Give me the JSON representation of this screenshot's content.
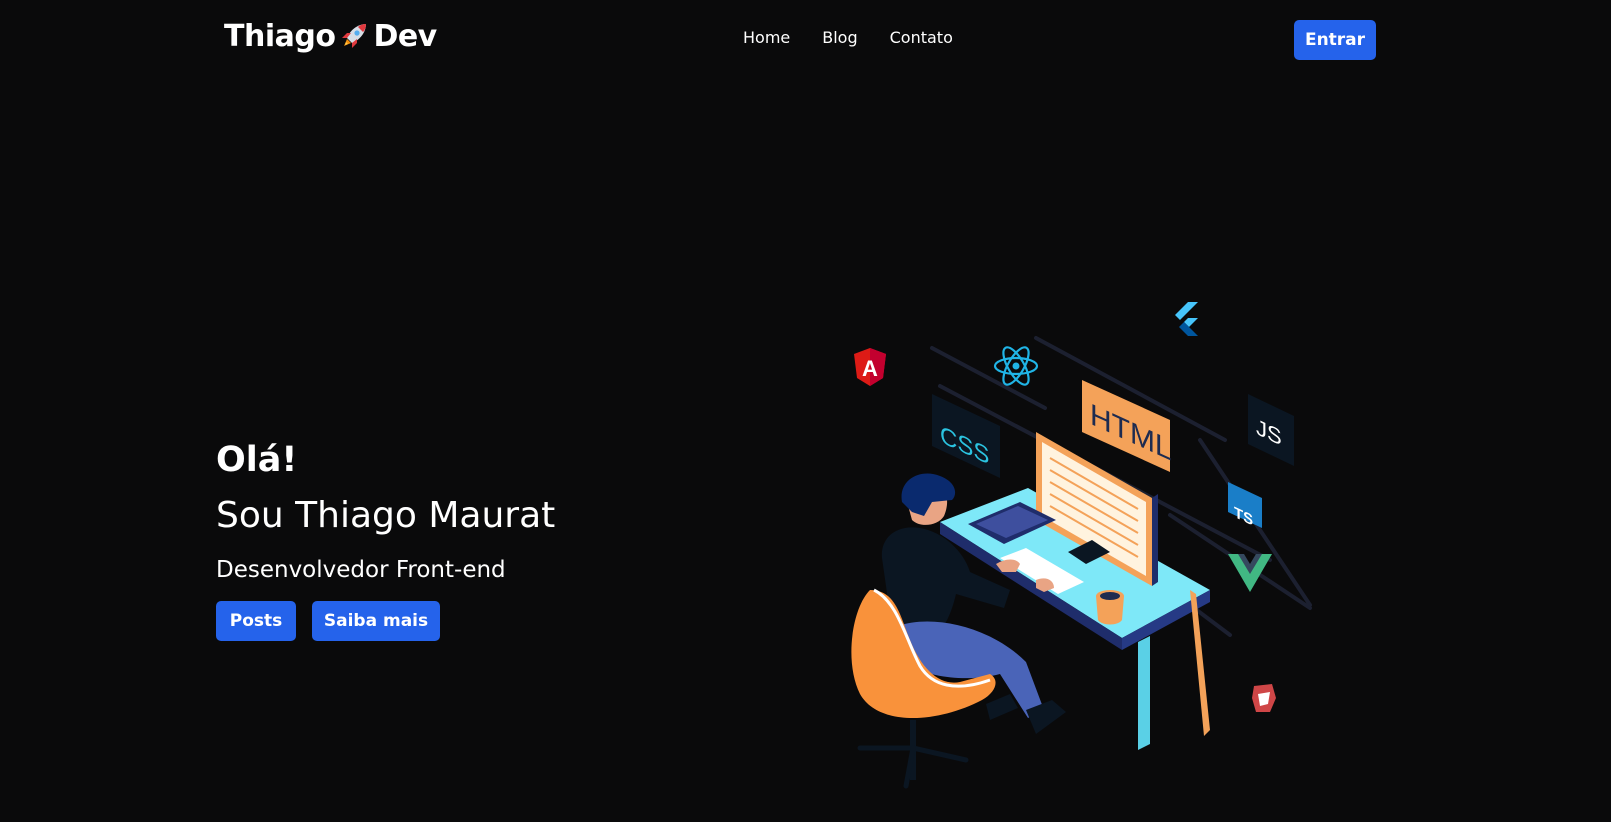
{
  "header": {
    "logo": {
      "left_text": "Thiago",
      "right_text": "Dev",
      "icon": "rocket-icon"
    },
    "nav": [
      {
        "label": "Home"
      },
      {
        "label": "Blog"
      },
      {
        "label": "Contato"
      }
    ],
    "login_label": "Entrar"
  },
  "hero": {
    "greeting": "Olá!",
    "name": "Sou Thiago Maurat",
    "role": "Desenvolvedor Front-end",
    "buttons": {
      "posts_label": "Posts",
      "more_label": "Saiba mais"
    }
  },
  "illustration": {
    "monitor_label": "HTML",
    "tags": {
      "css": "CSS",
      "js": "JS",
      "ts": "TS",
      "angular": "A"
    },
    "icons": [
      "angular-icon",
      "react-icon",
      "flutter-icon",
      "javascript-icon",
      "typescript-icon",
      "vue-icon",
      "gulp-icon",
      "css-icon"
    ]
  },
  "colors": {
    "background": "#0a0a0b",
    "accent": "#2563eb",
    "text": "#ffffff",
    "desk": "#7ee8f8",
    "chair": "#f9923b",
    "html_tag": "#f4a259"
  }
}
